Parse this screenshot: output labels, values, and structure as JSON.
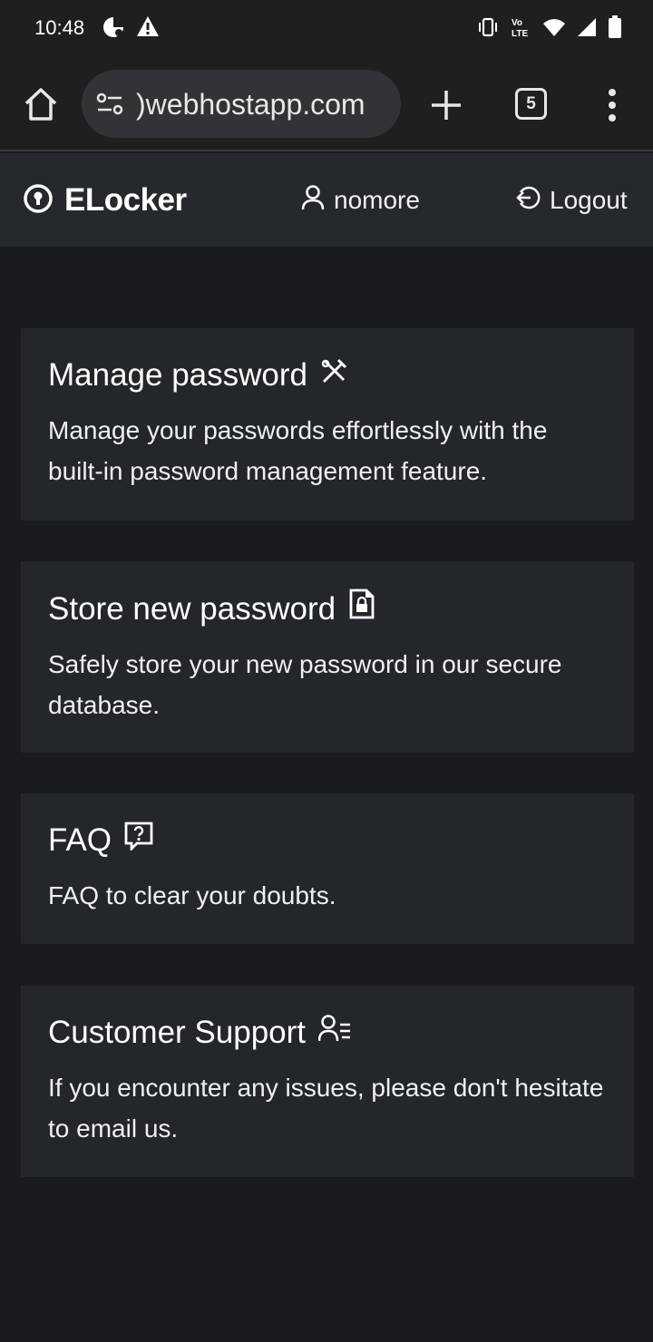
{
  "status_bar": {
    "time": "10:48",
    "left_icons": [
      "app-notification-icon",
      "warning-icon"
    ],
    "right_icons": [
      "vibrate-icon",
      "volte-icon",
      "wifi-icon",
      "signal-icon",
      "battery-icon"
    ],
    "volte_label": "VoLTE"
  },
  "browser": {
    "url": ")webhostapp.com",
    "tab_count": "5"
  },
  "navbar": {
    "brand": "ELocker",
    "username": "nomore",
    "logout": "Logout"
  },
  "cards": [
    {
      "title": "Manage password",
      "icon": "tools-icon",
      "description": "Manage your passwords effortlessly with the built-in password management feature."
    },
    {
      "title": "Store new password",
      "icon": "file-lock-icon",
      "description": "Safely store your new password in our secure database."
    },
    {
      "title": "FAQ",
      "icon": "question-square-icon",
      "description": "FAQ to clear your doubts."
    },
    {
      "title": "Customer Support",
      "icon": "person-lines-icon",
      "description": "If you encounter any issues, please don't hesitate to email us."
    }
  ],
  "colors": {
    "page_bg": "#1a1b1e",
    "navbar_bg": "#25282d",
    "card_bg": "#23262b",
    "browser_bg": "#1f1f1f",
    "url_pill_bg": "#323336"
  }
}
